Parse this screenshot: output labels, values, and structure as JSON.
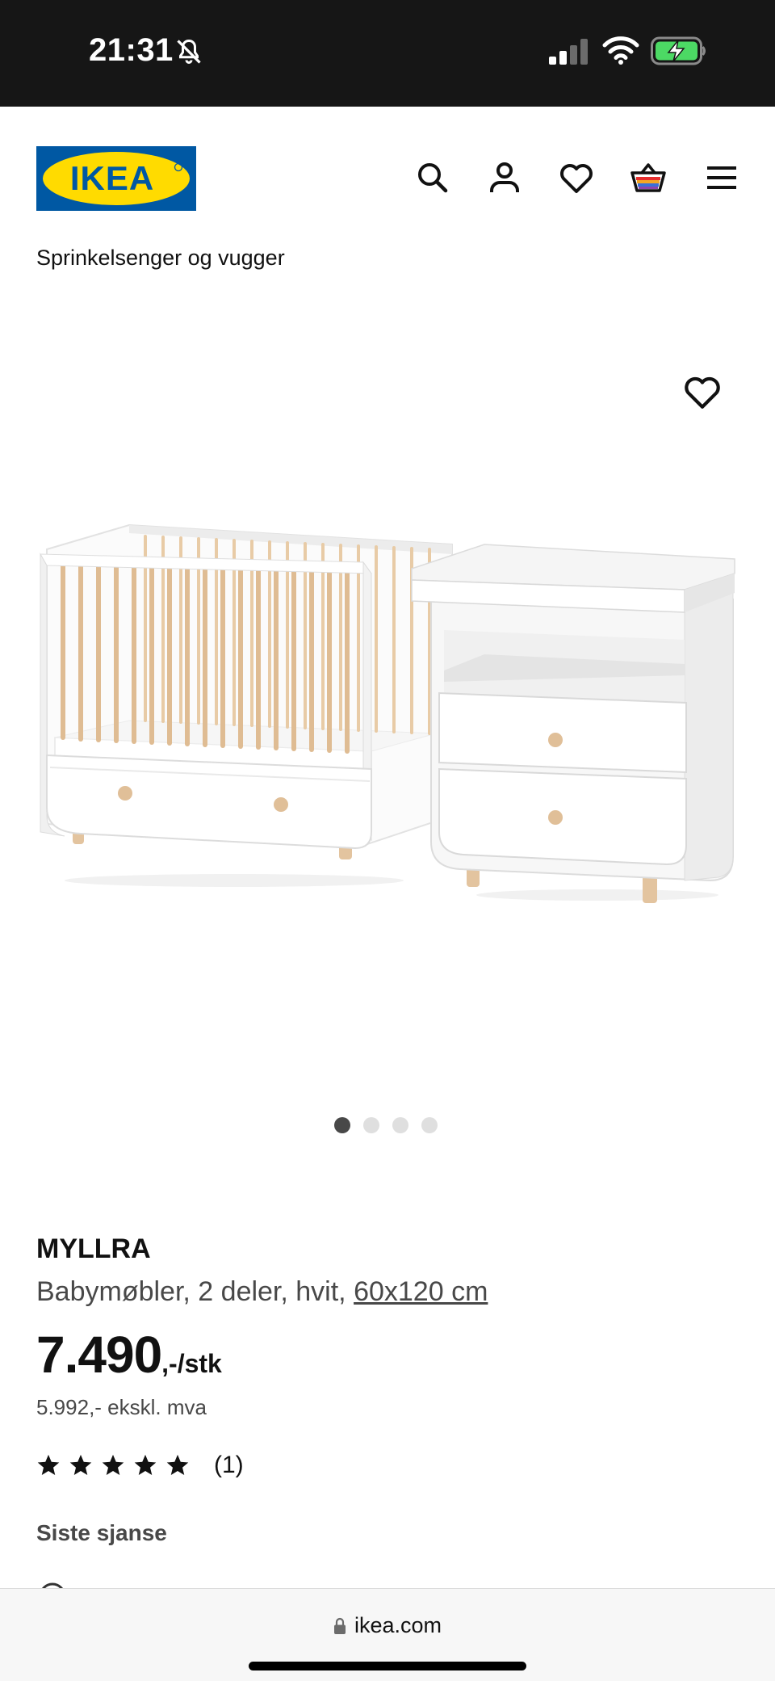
{
  "status_bar": {
    "time": "21:31",
    "icons": [
      "bell-slash-icon",
      "signal-icon",
      "wifi-icon",
      "battery-charging-icon"
    ]
  },
  "header": {
    "logo_text": "IKEA",
    "icons": [
      "search-icon",
      "user-icon",
      "heart-icon",
      "basket-icon",
      "menu-icon"
    ]
  },
  "breadcrumb": "Sprinkelsenger og vugger",
  "gallery": {
    "image_count": 4,
    "active_index": 0
  },
  "product": {
    "name": "MYLLRA",
    "description": "Babymøbler, 2 deler, hvit, ",
    "size_link": "60x120 cm",
    "price": "7.490",
    "price_suffix": ",-/stk",
    "price_ex_vat": "5.992,- ekskl. mva",
    "rating_stars": 5,
    "rating_count": "(1)",
    "tag": "Siste sjanse"
  },
  "browser": {
    "url": "ikea.com"
  },
  "colors": {
    "ikea_blue": "#0058a3",
    "ikea_yellow": "#ffdb00",
    "text_dark": "#111111",
    "text_muted": "#484848",
    "battery_green": "#4cd964"
  }
}
